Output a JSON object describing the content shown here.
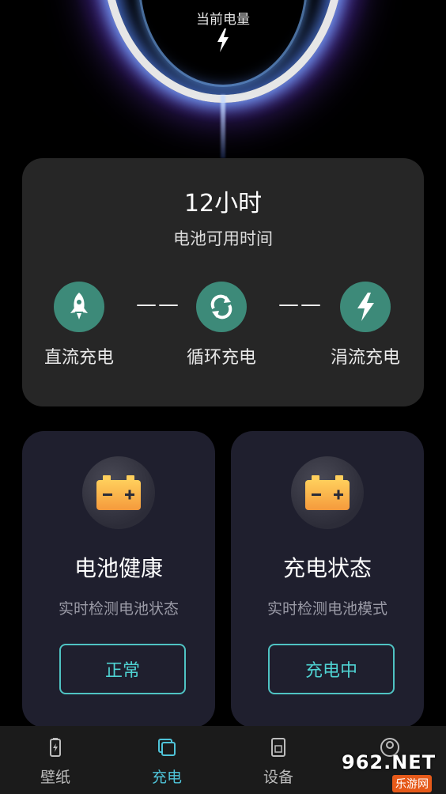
{
  "header": {
    "title": "当前电量"
  },
  "main_card": {
    "hours": "12小时",
    "hours_label": "电池可用时间",
    "separator": "——",
    "modes": [
      {
        "label": "直流充电",
        "icon": "rocket-icon"
      },
      {
        "label": "循环充电",
        "icon": "cycle-icon"
      },
      {
        "label": "涓流充电",
        "icon": "lightning-icon"
      }
    ]
  },
  "cards": [
    {
      "title": "电池健康",
      "subtitle": "实时检测电池状态",
      "button": "正常",
      "icon": "battery-icon"
    },
    {
      "title": "充电状态",
      "subtitle": "实时检测电池模式",
      "button": "充电中",
      "icon": "battery-icon"
    }
  ],
  "nav": {
    "items": [
      {
        "label": "壁纸",
        "icon": "battery-charge-icon",
        "active": false
      },
      {
        "label": "充电",
        "icon": "layers-icon",
        "active": true
      },
      {
        "label": "设备",
        "icon": "device-icon",
        "active": false
      },
      {
        "label": "",
        "icon": "user-icon",
        "active": false
      }
    ]
  },
  "watermark": {
    "text": "962.NET",
    "sub": "乐游网"
  },
  "colors": {
    "accent": "#4fc3c3",
    "mode_circle": "#3d8a79",
    "battery_orange": "#f5a623"
  }
}
